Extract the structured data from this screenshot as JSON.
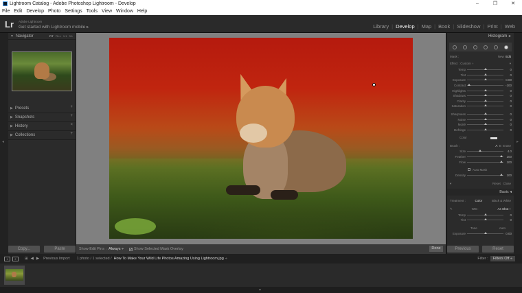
{
  "window": {
    "title": "Lightroom Catalog - Adobe Photoshop Lightroom - Develop",
    "controls": [
      "–",
      "❐",
      "✕"
    ]
  },
  "menu": [
    "File",
    "Edit",
    "Develop",
    "Photo",
    "Settings",
    "Tools",
    "View",
    "Window",
    "Help"
  ],
  "identity": {
    "logo": "Lr",
    "subtitle": "Adobe Lightroom",
    "mobile_prompt": "Get started with Lightroom mobile ▸"
  },
  "modules": [
    "Library",
    "Develop",
    "Map",
    "Book",
    "Slideshow",
    "Print",
    "Web"
  ],
  "active_module": "Develop",
  "left_panel": {
    "navigator": {
      "label": "Navigator",
      "options": [
        "FIT",
        "FILL",
        "1:1",
        "3:1"
      ]
    },
    "sections": [
      "Presets",
      "Snapshots",
      "History",
      "Collections"
    ],
    "copy_button": "Copy...",
    "paste_button": "Paste"
  },
  "toolbar": {
    "show_edit_pins_label": "Show Edit Pins :",
    "show_edit_pins_value": "Always ÷",
    "show_overlay_label": "Show Selected Mask Overlay",
    "done_button": "Done"
  },
  "right_panel": {
    "histogram_label": "Histogram ◂",
    "mask": {
      "label": "Mask :",
      "new": "New",
      "edit": "Edit"
    },
    "effect": {
      "label": "Effect :",
      "value": "Custom ÷"
    },
    "sliders_top": [
      {
        "label": "Temp",
        "value": "0",
        "pos": 0.5
      },
      {
        "label": "Tint",
        "value": "0",
        "pos": 0.5
      },
      {
        "label": "Exposure",
        "value": "0.00",
        "pos": 0.5
      },
      {
        "label": "Contrast",
        "value": "-100",
        "pos": 0.05
      },
      {
        "label": "Highlights",
        "value": "0",
        "pos": 0.5
      },
      {
        "label": "Shadows",
        "value": "0",
        "pos": 0.5
      },
      {
        "label": "Clarity",
        "value": "0",
        "pos": 0.5
      },
      {
        "label": "Saturation",
        "value": "0",
        "pos": 0.5
      }
    ],
    "sliders_mid": [
      {
        "label": "Sharpness",
        "value": "0",
        "pos": 0.5
      },
      {
        "label": "Noise",
        "value": "0",
        "pos": 0.5
      },
      {
        "label": "Moiré",
        "value": "0",
        "pos": 0.5
      },
      {
        "label": "Defringe",
        "value": "0",
        "pos": 0.5
      }
    ],
    "color_label": "Color",
    "brush": {
      "label": "Brush :",
      "a": "A",
      "b": "B",
      "erase": "Erase"
    },
    "brush_sliders": [
      {
        "label": "Size",
        "value": "4.0",
        "pos": 0.35
      },
      {
        "label": "Feather",
        "value": "100",
        "pos": 0.95
      },
      {
        "label": "Flow",
        "value": "100",
        "pos": 0.95
      }
    ],
    "auto_mask": "Auto Mask",
    "density": {
      "label": "Density",
      "value": "100",
      "pos": 0.95
    },
    "reset": "Reset",
    "close": "Close",
    "basic": {
      "label": "Basic ◂",
      "treatment": "Treatment :",
      "color": "Color",
      "bw": "Black & White",
      "wb_label": "WB :",
      "wb_value": "As Shot ÷",
      "sliders": [
        {
          "label": "Temp",
          "value": "0",
          "pos": 0.5
        },
        {
          "label": "Tint",
          "value": "0",
          "pos": 0.5
        }
      ],
      "tone": "Tone",
      "auto": "Auto",
      "exposure": {
        "label": "Exposure",
        "value": "0.00",
        "pos": 0.5
      }
    },
    "previous_button": "Previous",
    "reset_button": "Reset"
  },
  "filmstrip": {
    "page1": "1",
    "page2": "2",
    "source_label": "Previous Import",
    "count_text": "1 photo / 1 selected /",
    "filename": "How To Make Your Wild Life Photos Amazing Using Lightroom.jpg",
    "filename_suffix": "÷",
    "filter_label": "Filter :",
    "filter_value": "Filters Off ÷"
  },
  "colors": {
    "background": "#1a1a1a",
    "panel": "#2b2b2b",
    "center": "#808080",
    "mask_overlay": "#b51a0e"
  }
}
